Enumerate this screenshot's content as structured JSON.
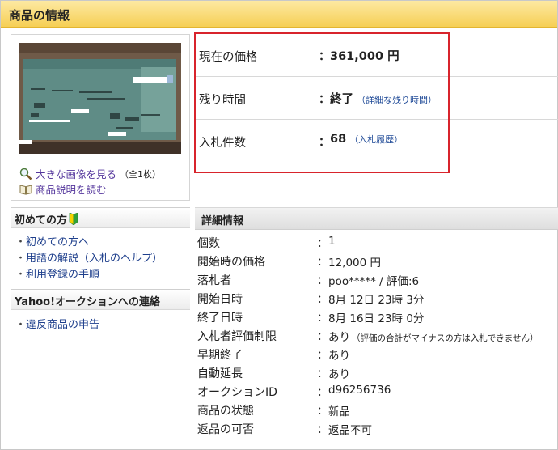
{
  "header": {
    "title": "商品の情報"
  },
  "image_panel": {
    "enlarge_link": "大きな画像を見る",
    "enlarge_count": "（全1枚）",
    "description_link": "商品説明を読む"
  },
  "price_info": [
    {
      "label": "現在の価格",
      "value": "361,000 円",
      "link": ""
    },
    {
      "label": "残り時間",
      "value": "終了",
      "link": "（詳細な残り時間）"
    },
    {
      "label": "入札件数",
      "value": "68",
      "link": "（入札履歴）"
    }
  ],
  "sidebar": {
    "beginners": {
      "title": "初めての方",
      "links": [
        "初めての方へ",
        "用語の解説（入札のヘルプ）",
        "利用登録の手順"
      ]
    },
    "contact": {
      "title": "Yahoo!オークションへの連絡",
      "links": [
        "違反商品の申告"
      ]
    }
  },
  "details": {
    "title": "詳細情報",
    "rows": [
      {
        "label": "個数",
        "value": "1",
        "note": ""
      },
      {
        "label": "開始時の価格",
        "value": "12,000 円",
        "note": ""
      },
      {
        "label": "落札者",
        "value": "poo***** / 評価:6",
        "note": ""
      },
      {
        "label": "開始日時",
        "value": "8月 12日 23時 3分",
        "note": ""
      },
      {
        "label": "終了日時",
        "value": "8月 16日 23時 0分",
        "note": ""
      },
      {
        "label": "入札者評価制限",
        "value": "あり",
        "note": "（評価の合計がマイナスの方は入札できません）"
      },
      {
        "label": "早期終了",
        "value": "あり",
        "note": ""
      },
      {
        "label": "自動延長",
        "value": "あり",
        "note": ""
      },
      {
        "label": "オークションID",
        "value": "d96256736",
        "note": ""
      },
      {
        "label": "商品の状態",
        "value": "新品",
        "note": ""
      },
      {
        "label": "返品の可否",
        "value": "返品不可",
        "note": ""
      }
    ]
  },
  "colors": {
    "header_bg": "#f6cf55",
    "highlight_border": "#d8242c",
    "link": "#1e3f8c",
    "visited_link": "#54369c"
  },
  "icons": {
    "enlarge": "magnifier-icon",
    "description": "book-icon",
    "beginner": "beginner-mark-icon"
  }
}
